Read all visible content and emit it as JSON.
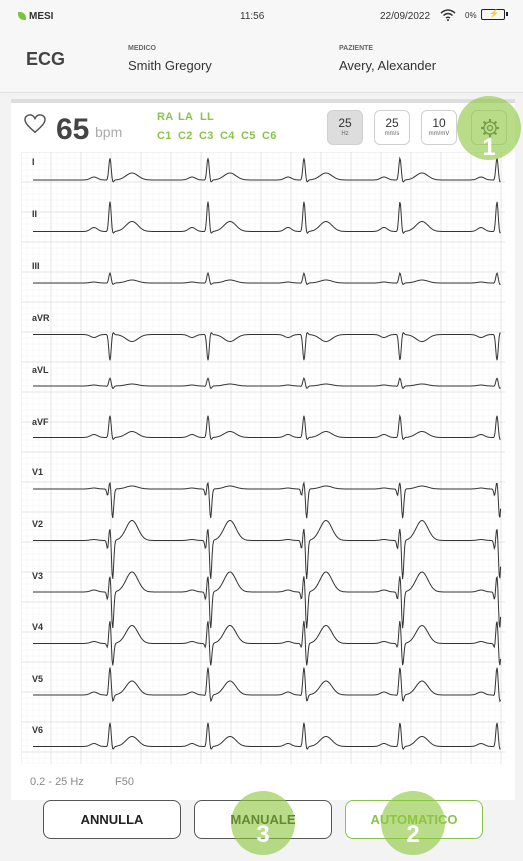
{
  "status_bar": {
    "carrier": "MESI",
    "time": "11:56",
    "date": "22/09/2022",
    "battery": "0%"
  },
  "header": {
    "title": "ECG",
    "doctor_label": "MEDICO",
    "doctor_name": "Smith Gregory",
    "patient_label": "PAZIENTE",
    "patient_name": "Avery, Alexander"
  },
  "vitals": {
    "heart_rate": "65",
    "unit": "bpm"
  },
  "leads_row1": [
    "RA",
    "LA",
    "LL"
  ],
  "leads_row2": [
    "C1",
    "C2",
    "C3",
    "C4",
    "C5",
    "C6"
  ],
  "settings": {
    "filter": {
      "value": "25",
      "unit": "Hz"
    },
    "speed": {
      "value": "25",
      "unit": "mm/s"
    },
    "gain": {
      "value": "10",
      "unit": "mm/mV"
    }
  },
  "ecg": {
    "lead_labels": [
      "I",
      "II",
      "III",
      "aVR",
      "aVL",
      "aVF",
      "V1",
      "V2",
      "V3",
      "V4",
      "V5",
      "V6"
    ],
    "filter_range": "0.2 - 25 Hz",
    "notch": "F50"
  },
  "buttons": {
    "cancel": "ANNULLA",
    "manual": "MANUALE",
    "automatic": "AUTOMATICO"
  },
  "steps": [
    "1",
    "2",
    "3"
  ],
  "colors": {
    "accent": "#8bc34a",
    "highlight": "#8dc63f"
  }
}
